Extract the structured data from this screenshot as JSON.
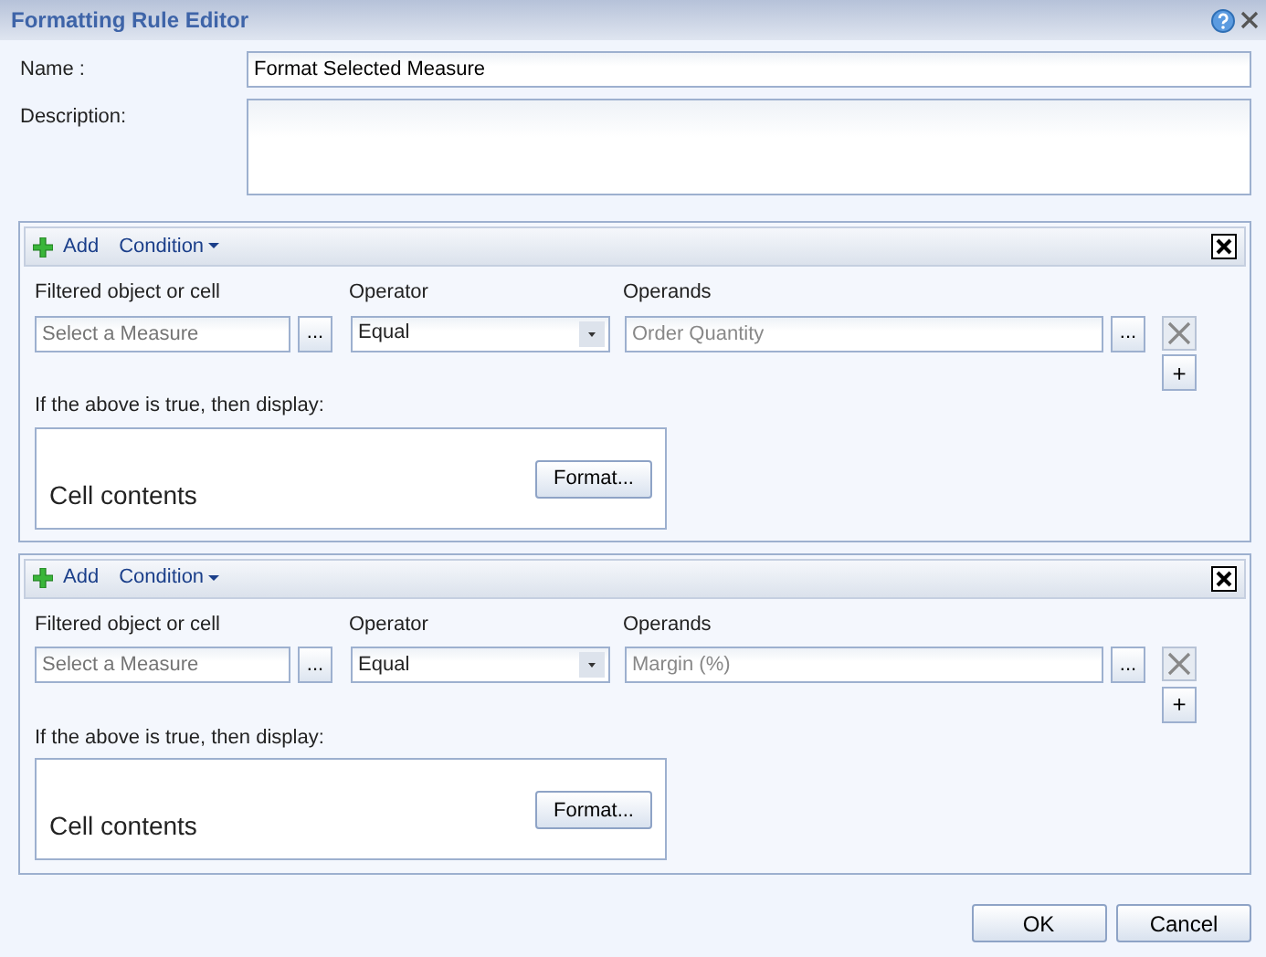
{
  "window": {
    "title": "Formatting Rule Editor"
  },
  "name_label": "Name :",
  "name_value": "Format Selected Measure",
  "description_label": "Description:",
  "conditions": [
    {
      "add": "Add",
      "condition_menu": "Condition",
      "filtered_label": "Filtered object or cell",
      "filtered_placeholder": "Select a Measure",
      "browse": "...",
      "operator_label": "Operator",
      "operator": "Equal",
      "operands_label": "Operands",
      "operand": "Order Quantity",
      "operand_browse": "...",
      "add_operand": "+",
      "display_label": "If the above is true, then display:",
      "cell_contents": "Cell contents",
      "format_button": "Format..."
    },
    {
      "add": "Add",
      "condition_menu": "Condition",
      "filtered_label": "Filtered object or cell",
      "filtered_placeholder": "Select a Measure",
      "browse": "...",
      "operator_label": "Operator",
      "operator": "Equal",
      "operands_label": "Operands",
      "operand": "Margin (%)",
      "operand_browse": "...",
      "add_operand": "+",
      "display_label": "If the above is true, then display:",
      "cell_contents": "Cell contents",
      "format_button": "Format..."
    }
  ],
  "buttons": [
    "OK",
    "Cancel"
  ]
}
